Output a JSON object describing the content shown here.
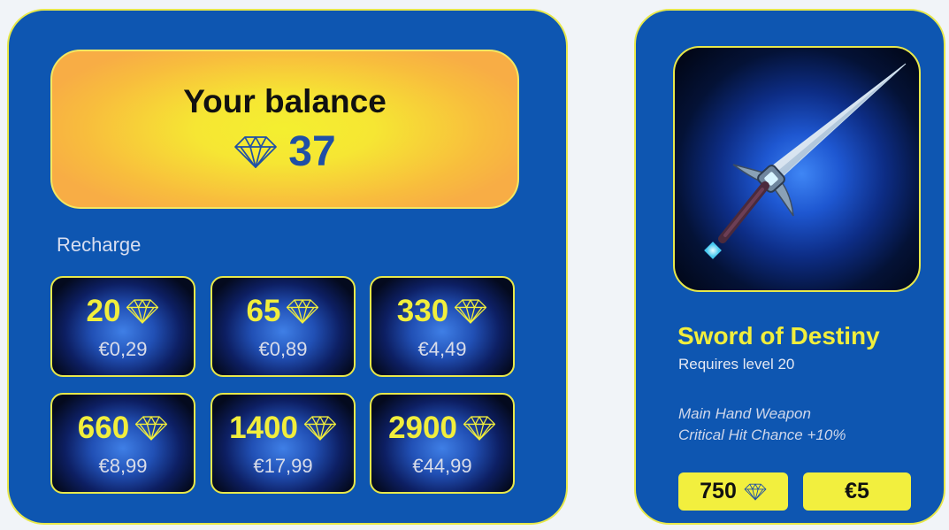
{
  "balance": {
    "title": "Your balance",
    "amount": "37",
    "icon": "diamond-icon"
  },
  "recharge": {
    "label": "Recharge",
    "packs": [
      {
        "qty": "20",
        "price": "€0,29"
      },
      {
        "qty": "65",
        "price": "€0,89"
      },
      {
        "qty": "330",
        "price": "€4,49"
      },
      {
        "qty": "660",
        "price": "€8,99"
      },
      {
        "qty": "1400",
        "price": "€17,99"
      },
      {
        "qty": "2900",
        "price": "€44,99"
      }
    ]
  },
  "item": {
    "name": "Sword of Destiny",
    "requirement": "Requires level 20",
    "type": "Main Hand Weapon",
    "stat": "Critical Hit Chance +10%",
    "price_gems": "750",
    "price_cash": "€5",
    "image": "sword-icon"
  },
  "colors": {
    "panel": "#0e56b1",
    "accent_yellow": "#f1ee3c",
    "balance_blue": "#1f4fa6",
    "page_bg": "#f1f4f8"
  }
}
